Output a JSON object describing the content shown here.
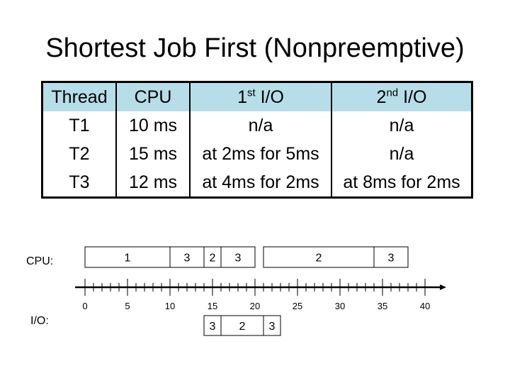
{
  "title": "Shortest Job First (Nonpreemptive)",
  "table": {
    "headers": [
      {
        "main": "Thread",
        "sup": "",
        "rest": ""
      },
      {
        "main": "CPU",
        "sup": "",
        "rest": ""
      },
      {
        "main": "1",
        "sup": "st",
        "rest": " I/O"
      },
      {
        "main": "2",
        "sup": "nd",
        "rest": " I/O"
      }
    ],
    "header_bg": "#b7dde8",
    "rows": [
      [
        "T1",
        "10 ms",
        "n/a",
        "n/a"
      ],
      [
        "T2",
        "15 ms",
        "at 2ms for 5ms",
        "n/a"
      ],
      [
        "T3",
        "12 ms",
        "at 4ms for 2ms",
        "at 8ms for 2ms"
      ]
    ]
  },
  "labels": {
    "cpu": "CPU:",
    "io": "I/O:"
  },
  "timeline": {
    "axis_min": 0,
    "axis_max": 40,
    "major_ticks": [
      0,
      5,
      10,
      15,
      20,
      25,
      30,
      35,
      40
    ],
    "minor_step": 1,
    "cpu_segments": [
      {
        "thread": "1",
        "start": 0,
        "end": 10
      },
      {
        "thread": "3",
        "start": 10,
        "end": 14
      },
      {
        "thread": "2",
        "start": 14,
        "end": 16
      },
      {
        "thread": "3",
        "start": 16,
        "end": 20
      },
      {
        "thread": "2",
        "start": 21,
        "end": 34
      },
      {
        "thread": "3",
        "start": 34,
        "end": 38
      }
    ],
    "io_segments": [
      {
        "thread": "3",
        "start": 14,
        "end": 16
      },
      {
        "thread": "2",
        "start": 16,
        "end": 21
      },
      {
        "thread": "3",
        "start": 21,
        "end": 23
      }
    ]
  }
}
